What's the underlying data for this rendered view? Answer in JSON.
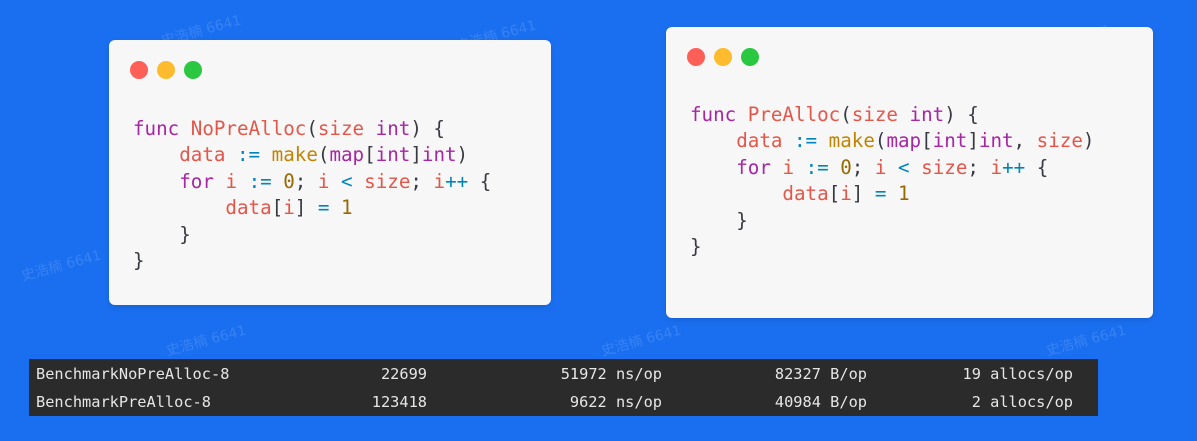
{
  "watermark": "史浩楠 6641",
  "code_left": {
    "line1": {
      "kw": "func",
      "name": "NoPreAlloc",
      "p1": "(",
      "param": "size",
      "type": "int",
      "p2": ") {"
    },
    "line2": {
      "var": "data",
      "op": ":=",
      "call": "make",
      "p1": "(",
      "map": "map",
      "b1": "[",
      "t1": "int",
      "b2": "]",
      "t2": "int",
      "p2": ")"
    },
    "line3": {
      "kw": "for",
      "i": "i",
      "op": ":=",
      "zero": "0",
      "semi1": ";",
      "i2": "i",
      "lt": "<",
      "size": "size",
      "semi2": ";",
      "i3": "i",
      "inc": "++",
      "brace": "{"
    },
    "line4": {
      "data": "data",
      "b1": "[",
      "i": "i",
      "b2": "]",
      "eq": "=",
      "one": "1"
    },
    "line5": "}",
    "line6": "}"
  },
  "code_right": {
    "line1": {
      "kw": "func",
      "name": "PreAlloc",
      "p1": "(",
      "param": "size",
      "type": "int",
      "p2": ") {"
    },
    "line2": {
      "var": "data",
      "op": ":=",
      "call": "make",
      "p1": "(",
      "map": "map",
      "b1": "[",
      "t1": "int",
      "b2": "]",
      "t2": "int",
      "comma": ",",
      "size": "size",
      "p2": ")"
    },
    "line3": {
      "kw": "for",
      "i": "i",
      "op": ":=",
      "zero": "0",
      "semi1": ";",
      "i2": "i",
      "lt": "<",
      "size": "size",
      "semi2": ";",
      "i3": "i",
      "inc": "++",
      "brace": "{"
    },
    "line4": {
      "data": "data",
      "b1": "[",
      "i": "i",
      "b2": "]",
      "eq": "=",
      "one": "1"
    },
    "line5": "}",
    "line6": "}"
  },
  "benchmarks": [
    {
      "name": "BenchmarkNoPreAlloc-8",
      "iterations": "22699",
      "ns": "51972 ns/op",
      "bytes": "82327 B/op",
      "allocs": "19 allocs/op"
    },
    {
      "name": "BenchmarkPreAlloc-8",
      "iterations": "123418",
      "ns": "9622 ns/op",
      "bytes": "40984 B/op",
      "allocs": "2 allocs/op"
    }
  ]
}
